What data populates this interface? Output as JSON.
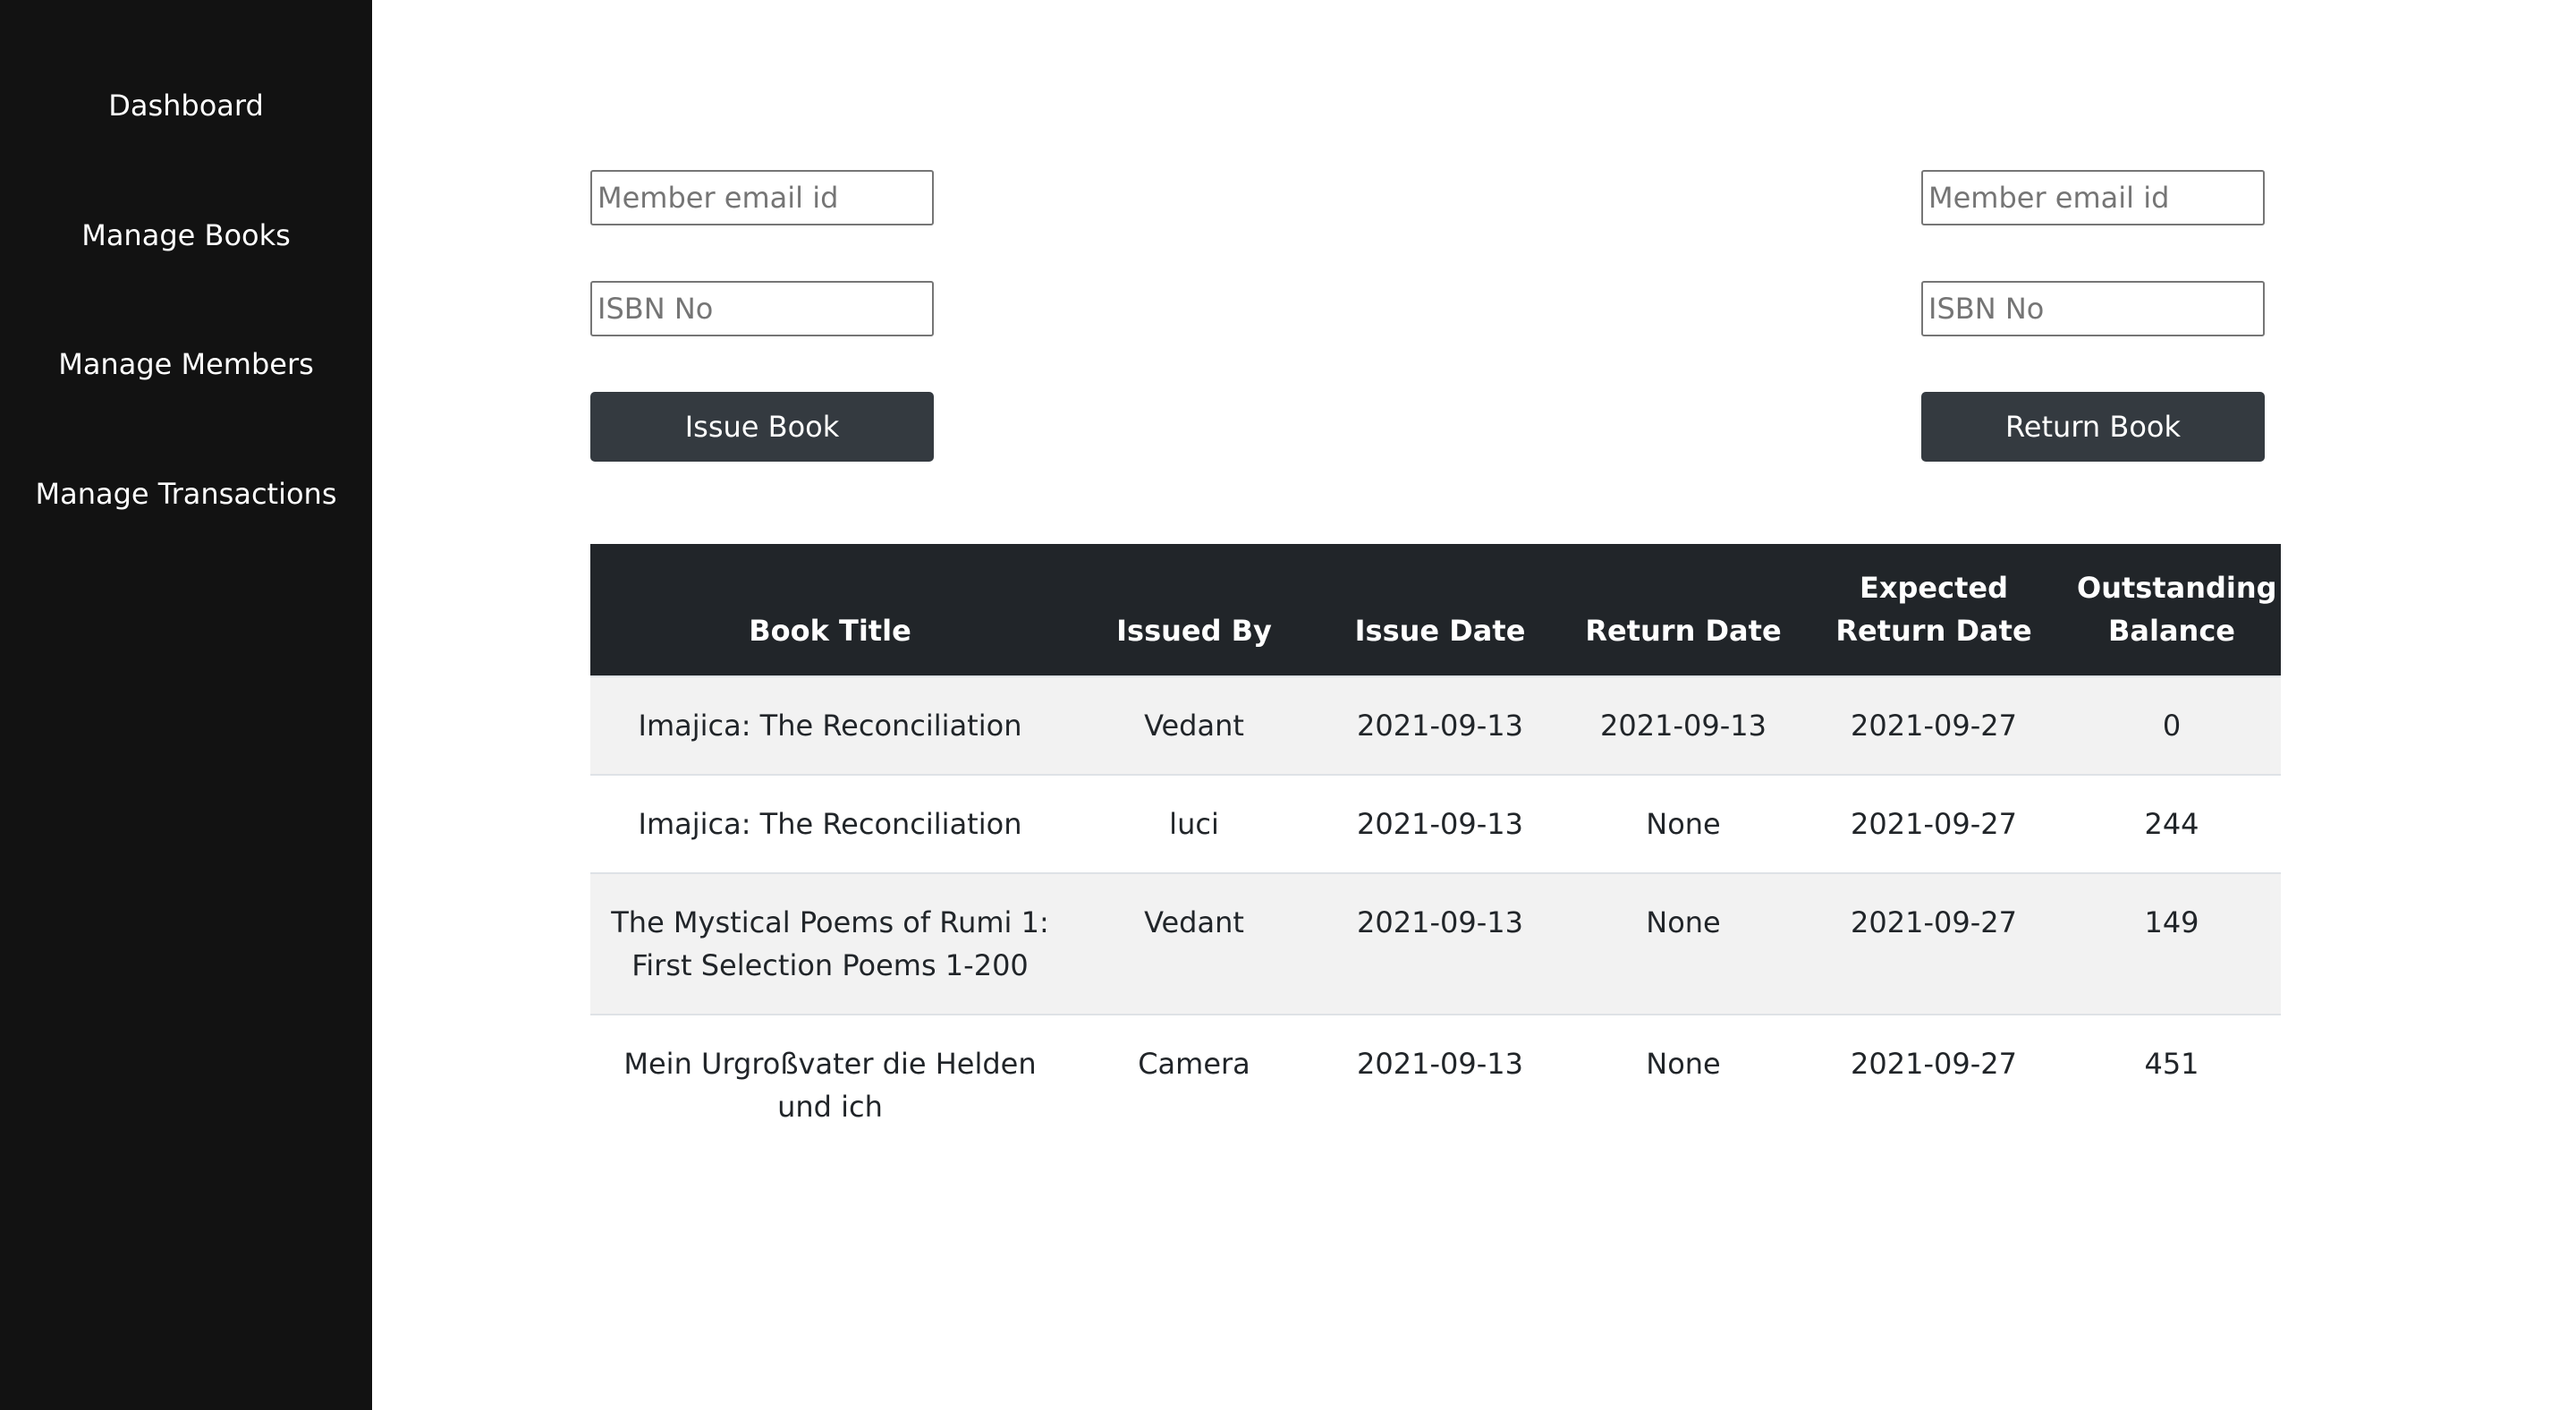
{
  "sidebar": {
    "items": [
      {
        "label": "Dashboard"
      },
      {
        "label": "Manage Books"
      },
      {
        "label": "Manage Members"
      },
      {
        "label": "Manage Transactions"
      }
    ]
  },
  "issue_form": {
    "email_placeholder": "Member email id",
    "email_value": "",
    "isbn_placeholder": "ISBN No",
    "isbn_value": "",
    "button_label": "Issue Book"
  },
  "return_form": {
    "email_placeholder": "Member email id",
    "email_value": "",
    "isbn_placeholder": "ISBN No",
    "isbn_value": "",
    "button_label": "Return Book"
  },
  "table": {
    "headers": {
      "book_title": "Book Title",
      "issued_by": "Issued By",
      "issue_date": "Issue Date",
      "return_date": "Return Date",
      "expected_return_date": "Expected Return Date",
      "outstanding_balance": "Outstanding Balance"
    },
    "rows": [
      {
        "book_title": "Imajica: The Reconciliation",
        "issued_by": "Vedant",
        "issue_date": "2021-09-13",
        "return_date": "2021-09-13",
        "expected_return_date": "2021-09-27",
        "outstanding_balance": "0"
      },
      {
        "book_title": "Imajica: The Reconciliation",
        "issued_by": "luci",
        "issue_date": "2021-09-13",
        "return_date": "None",
        "expected_return_date": "2021-09-27",
        "outstanding_balance": "244"
      },
      {
        "book_title": "The Mystical Poems of Rumi 1: First Selection Poems 1-200",
        "issued_by": "Vedant",
        "issue_date": "2021-09-13",
        "return_date": "None",
        "expected_return_date": "2021-09-27",
        "outstanding_balance": "149"
      },
      {
        "book_title": "Mein Urgroßvater die Helden und ich",
        "issued_by": "Camera",
        "issue_date": "2021-09-13",
        "return_date": "None",
        "expected_return_date": "2021-09-27",
        "outstanding_balance": "451"
      }
    ]
  },
  "colors": {
    "sidebar_bg": "#121212",
    "button_bg": "#343a40",
    "table_header_bg": "#212529",
    "striped_row_bg": "#f2f2f2"
  }
}
